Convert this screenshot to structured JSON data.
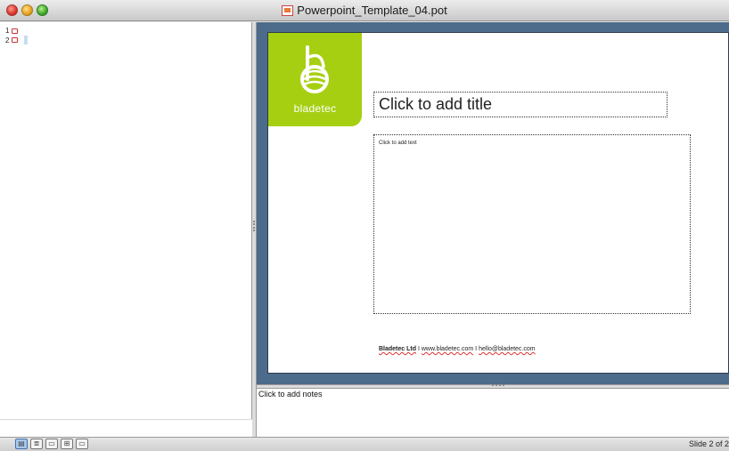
{
  "window": {
    "title": "Powerpoint_Template_04.pot"
  },
  "outline": {
    "items": [
      {
        "number": "1"
      },
      {
        "number": "2"
      }
    ]
  },
  "slide": {
    "logo_text": "bladetec",
    "title_placeholder": "Click to add title",
    "body_placeholder": "Click to add text",
    "footer": {
      "company": "Bladetec Ltd",
      "separator1": " I ",
      "website": "www.bladetec.com",
      "separator2": " I ",
      "email": "hello@bladetec.com"
    },
    "colors": {
      "background_frame": "#4d6b8a",
      "logo_green": "#a6cf12"
    }
  },
  "notes": {
    "placeholder": "Click to add notes"
  },
  "status": {
    "slide_count": "Slide 2 of 2"
  },
  "view_buttons": [
    {
      "name": "normal-view-icon",
      "glyph": "▤"
    },
    {
      "name": "outline-view-icon",
      "glyph": "≣"
    },
    {
      "name": "slide-view-icon",
      "glyph": "▭"
    },
    {
      "name": "slide-sorter-icon",
      "glyph": "⊞"
    },
    {
      "name": "slideshow-icon",
      "glyph": "▭"
    }
  ]
}
